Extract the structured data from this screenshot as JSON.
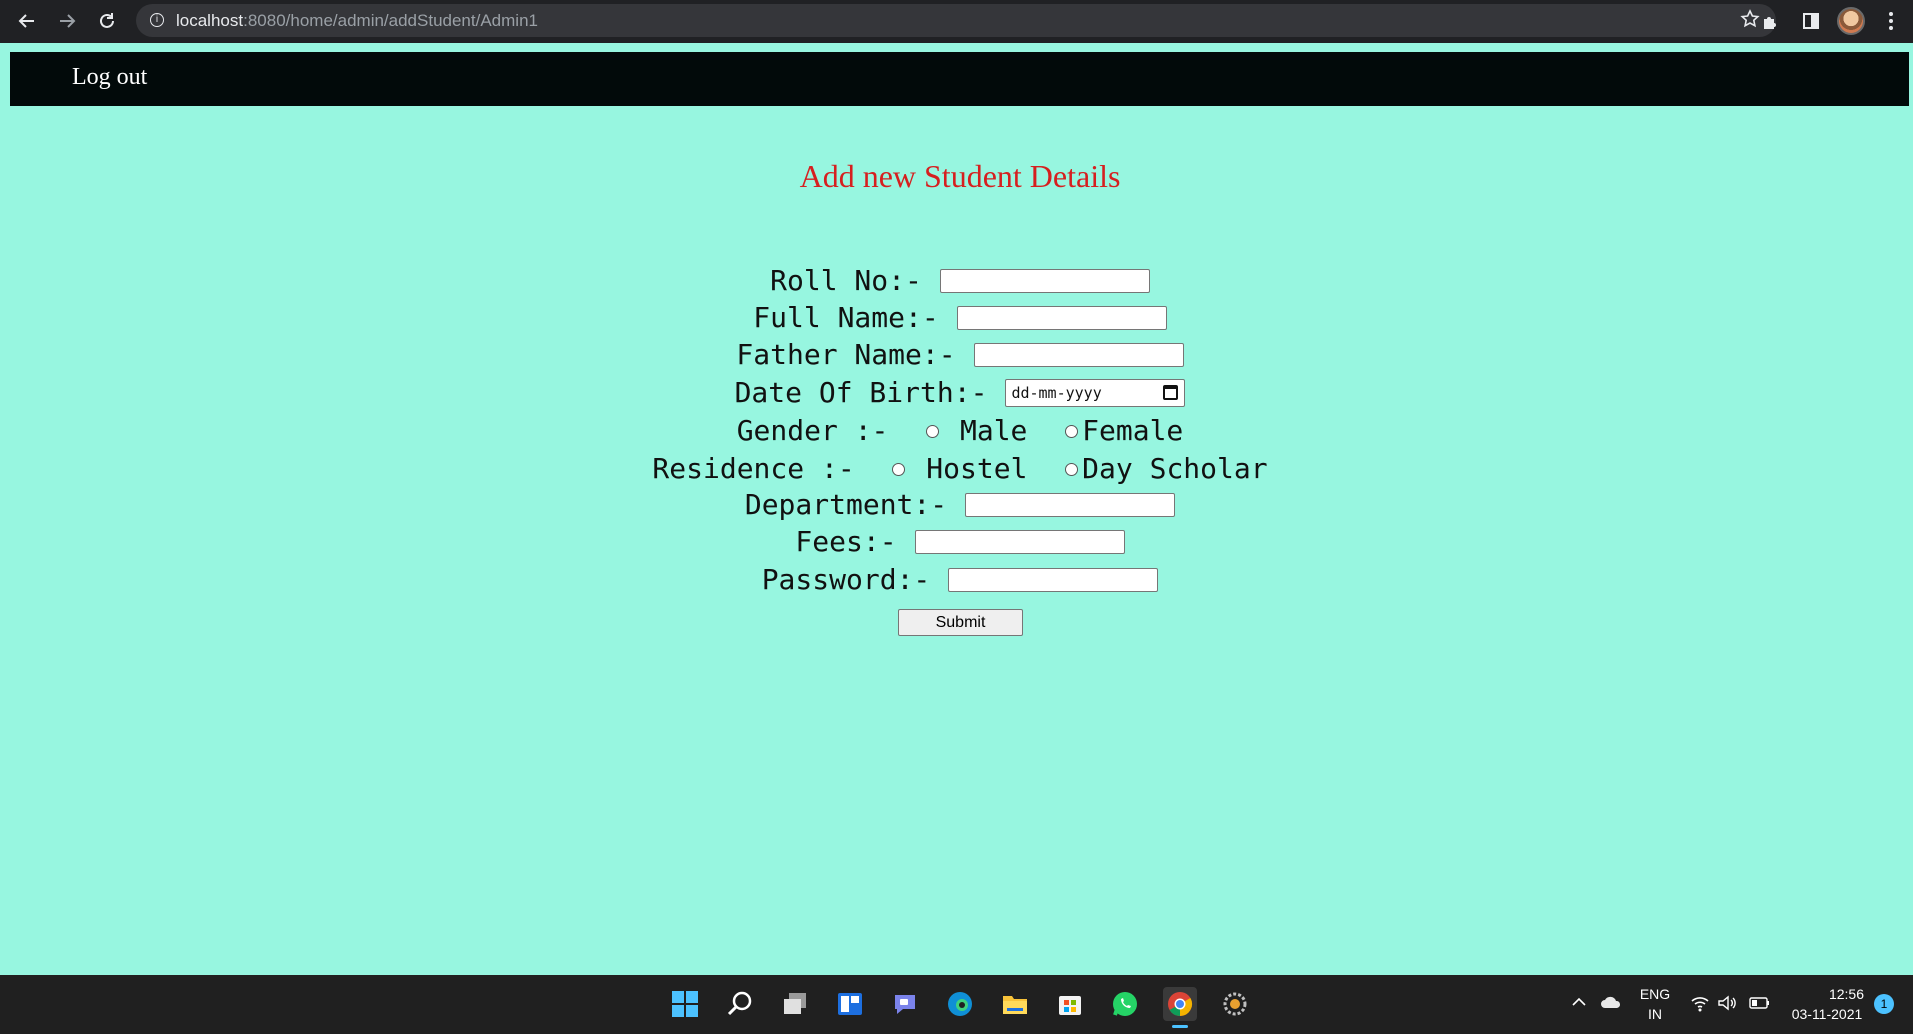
{
  "browser": {
    "url_host": "localhost",
    "url_path": ":8080/home/admin/addStudent/Admin1"
  },
  "navbar": {
    "logout_label": "Log out"
  },
  "page": {
    "heading": "Add new Student Details"
  },
  "form": {
    "roll_no_label": "Roll No:-",
    "full_name_label": "Full Name:-",
    "father_name_label": "Father Name:-",
    "dob_label": "Date Of Birth:-",
    "dob_placeholder": "dd-mm-yyyy",
    "gender_label": "Gender :-",
    "gender_options": [
      "Male",
      "Female"
    ],
    "residence_label": "Residence :-",
    "residence_options": [
      "Hostel",
      "Day Scholar"
    ],
    "department_label": "Department:-",
    "fees_label": "Fees:-",
    "password_label": "Password:-",
    "submit_label": "Submit"
  },
  "taskbar": {
    "language_line1": "ENG",
    "language_line2": "IN",
    "time": "12:56",
    "date": "03-11-2021",
    "notification_count": "1"
  },
  "colors": {
    "page_background": "#97f6e0",
    "navbar_background": "#020a0a",
    "heading_color": "#d61f1f",
    "accent": "#4cc2ff"
  },
  "icons": [
    "back-icon",
    "forward-icon",
    "reload-icon",
    "info-icon",
    "star-icon",
    "extensions-icon",
    "sidepanel-icon",
    "profile-avatar",
    "menu-icon",
    "windows-start-icon",
    "search-icon",
    "task-view-icon",
    "widgets-icon",
    "teams-chat-icon",
    "edge-icon",
    "file-explorer-icon",
    "store-icon",
    "whatsapp-icon",
    "chrome-icon",
    "settings-icon",
    "chevron-up-icon",
    "onedrive-icon",
    "wifi-icon",
    "volume-icon",
    "battery-icon"
  ]
}
